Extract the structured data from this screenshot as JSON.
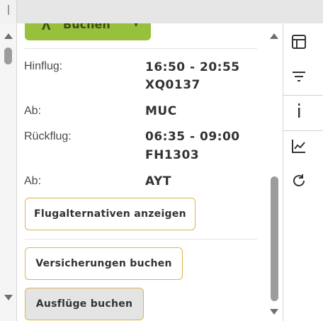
{
  "booking_button": {
    "label": "Buchen",
    "icon": "person-icon"
  },
  "flight": {
    "outbound_label": "Hinflug:",
    "outbound_time": "16:50 - 20:55",
    "outbound_number": "XQ0137",
    "outbound_from_label": "Ab:",
    "outbound_from": "MUC",
    "return_label": "Rückflug:",
    "return_time": "06:35 - 09:00",
    "return_number": "FH1303",
    "return_from_label": "Ab:",
    "return_from": "AYT"
  },
  "actions": {
    "alternatives": "Flugalternativen anzeigen",
    "insurance": "Versicherungen buchen",
    "excursions": "Ausflüge buchen"
  },
  "rail_icons": [
    "table-icon",
    "filter-icon",
    "info-icon",
    "chart-icon",
    "refresh-icon"
  ],
  "colors": {
    "accent_green": "#97c03c",
    "button_border": "#e0b14f"
  }
}
